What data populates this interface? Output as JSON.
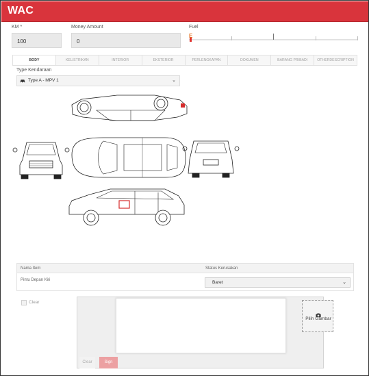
{
  "app": {
    "title": "WAC"
  },
  "form": {
    "km": {
      "label": "KM *",
      "value": "100"
    },
    "money": {
      "label": "Money Amount",
      "value": "0"
    },
    "fuel": {
      "label": "Fuel",
      "marker": "E"
    }
  },
  "tabs": [
    {
      "label": "BODY",
      "active": true
    },
    {
      "label": "KELISTRIKAN",
      "active": false
    },
    {
      "label": "INTERIOR",
      "active": false
    },
    {
      "label": "EKSTERIOR",
      "active": false
    },
    {
      "label": "PERLENGKAPAN",
      "active": false
    },
    {
      "label": "DOKUMEN",
      "active": false
    },
    {
      "label": "BARANG PRIBADI",
      "active": false
    },
    {
      "label": "OTHERDESCRIPTION",
      "active": false
    }
  ],
  "vehicle": {
    "type_label": "Type Kendaraan",
    "type_value": "Type A - MPV 1",
    "icons": {
      "car": "car-icon",
      "chevron": "chevron-down-icon"
    }
  },
  "damage_table": {
    "headers": {
      "item": "Nama Item",
      "status": "Status Kerusakan"
    },
    "rows": [
      {
        "item": "Pintu Depan Kiri",
        "status": "Baret"
      }
    ]
  },
  "signature": {
    "checkbox_label": "Clear",
    "clear_button": "Clear",
    "sign_button": "Sign",
    "photo_label": "Pilih Gambar",
    "photo_icon": "camera-icon"
  },
  "colors": {
    "header": "#d9343c",
    "fuel_marker": "#e0312e",
    "sign_button": "#eca0a2",
    "damage_mark": "#d62b2b"
  }
}
